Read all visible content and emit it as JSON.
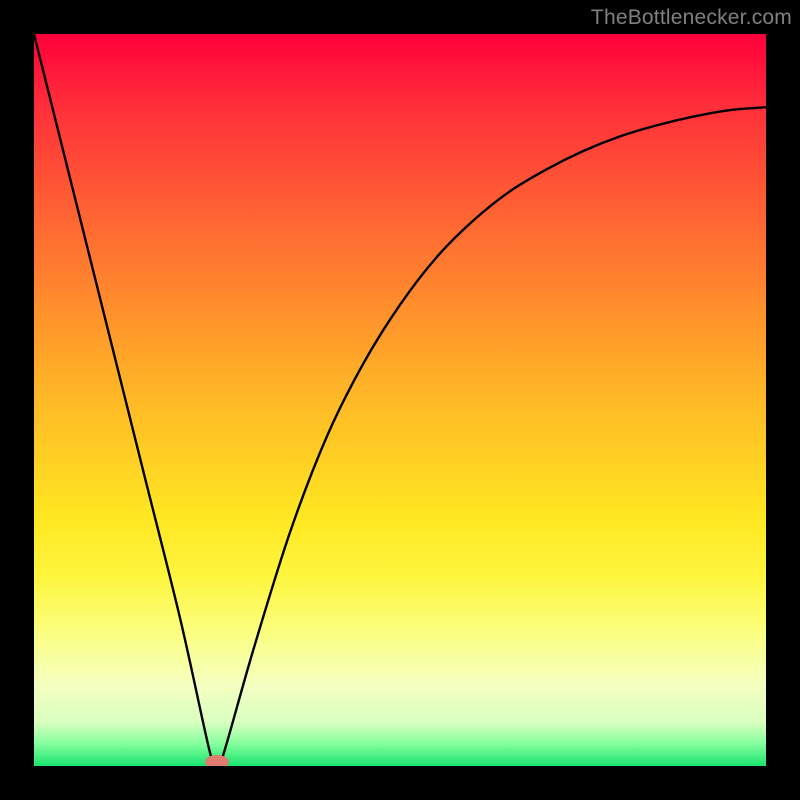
{
  "watermark": "TheBottlenecker.com",
  "chart_data": {
    "type": "line",
    "title": "",
    "xlabel": "",
    "ylabel": "",
    "xlim": [
      0,
      100
    ],
    "ylim": [
      0,
      100
    ],
    "x": [
      0,
      5,
      10,
      15,
      20,
      24,
      25,
      26,
      30,
      35,
      40,
      45,
      50,
      55,
      60,
      65,
      70,
      75,
      80,
      85,
      90,
      95,
      100
    ],
    "y": [
      100,
      80,
      60,
      40,
      20,
      2,
      0,
      2,
      16,
      32,
      45,
      55,
      63,
      69.5,
      74.5,
      78.5,
      81.5,
      84,
      86,
      87.5,
      88.7,
      89.6,
      90
    ],
    "minimum_marker": {
      "x": 25,
      "y": 0,
      "color": "#e17a6f"
    }
  }
}
